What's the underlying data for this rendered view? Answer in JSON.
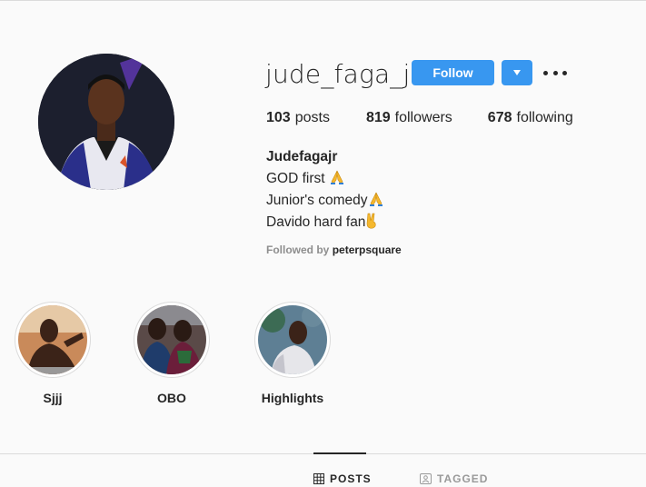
{
  "profile": {
    "username": "jude_faga_jr",
    "follow_label": "Follow",
    "stats": {
      "posts_count": "103",
      "posts_label": "posts",
      "followers_count": "819",
      "followers_label": "followers",
      "following_count": "678",
      "following_label": "following"
    },
    "bio": {
      "name": "Judefagajr",
      "line1": "GOD first ",
      "line2": "Junior's comedy",
      "line3": "Davido hard fan"
    },
    "followed_by_prefix": "Followed by",
    "followed_by_user": "peterpsquare"
  },
  "highlights": [
    {
      "label": "Sjjj"
    },
    {
      "label": "OBO"
    },
    {
      "label": "Highlights"
    }
  ],
  "tabs": {
    "posts": "POSTS",
    "tagged": "TAGGED"
  },
  "colors": {
    "accent": "#3897f0",
    "text": "#262626",
    "muted": "#8e8e8e",
    "background": "#fafafa"
  },
  "icons": {
    "bio_line1": "folded-hands-emoji",
    "bio_line2": "folded-hands-emoji",
    "bio_line3": "victory-hand-emoji"
  }
}
